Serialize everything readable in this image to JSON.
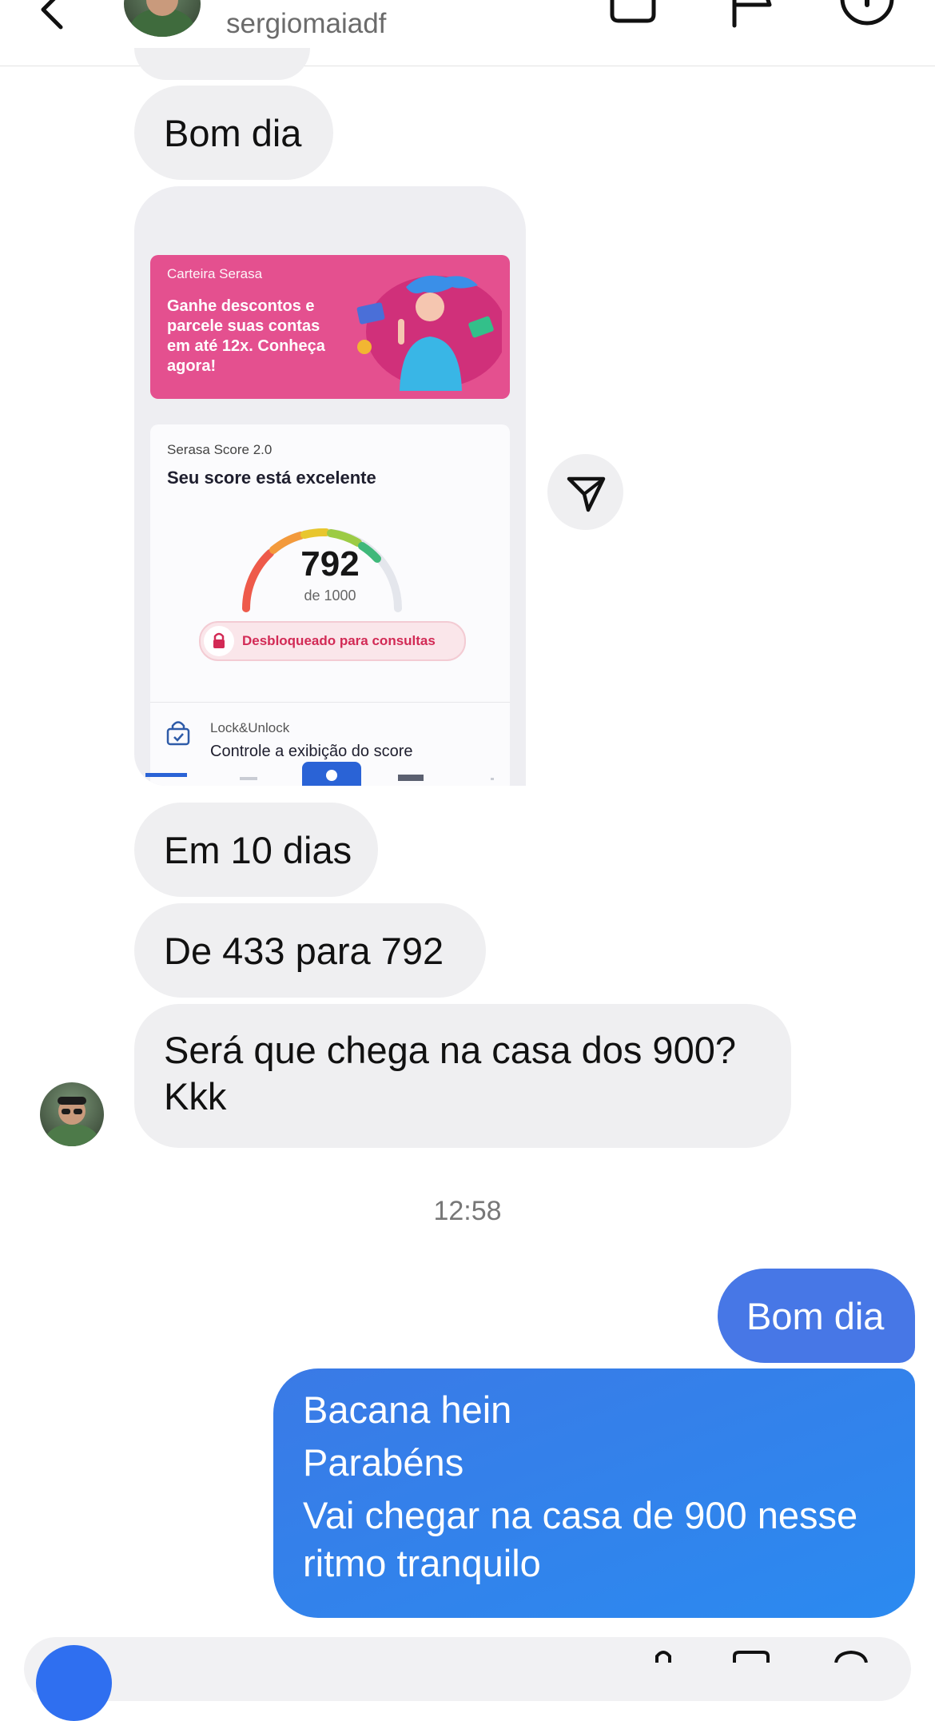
{
  "header": {
    "username": "sergiomaiadf"
  },
  "messages_in": {
    "greeting": "Bom dia",
    "days": "Em 10 dias",
    "score_change": "De 433 para 792",
    "question_line1": "Será que chega na casa dos 900?",
    "question_line2": "Kkk"
  },
  "shared_card": {
    "banner_caption": "Carteira Serasa",
    "banner_text": "Ganhe descontos e parcele suas contas em até 12x. Conheça agora!",
    "score_caption": "Serasa Score 2.0",
    "score_title": "Seu score está excelente",
    "score_value": "792",
    "score_max": "de 1000",
    "score_fraction": 0.792,
    "status_pill": "Desbloqueado para consultas",
    "lock_caption": "Lock&Unlock",
    "lock_text": "Controle a exibição do score"
  },
  "timestamp": "12:58",
  "messages_out": {
    "greeting": "Bom dia",
    "line1": "Bacana hein",
    "line2": "Parabéns",
    "line3": "Vai chegar na casa de 900 nesse",
    "line4": "ritmo tranquilo"
  },
  "icons": {
    "back": "back-arrow-icon",
    "video": "video-call-icon",
    "flag": "flag-icon",
    "info": "info-icon",
    "share": "share-icon",
    "camera": "camera-icon"
  },
  "colors": {
    "incoming_bubble": "#efeff1",
    "outgoing_bubble": "#3a7ae6",
    "banner": "#e4508f",
    "status_pill_text": "#d22a55"
  }
}
